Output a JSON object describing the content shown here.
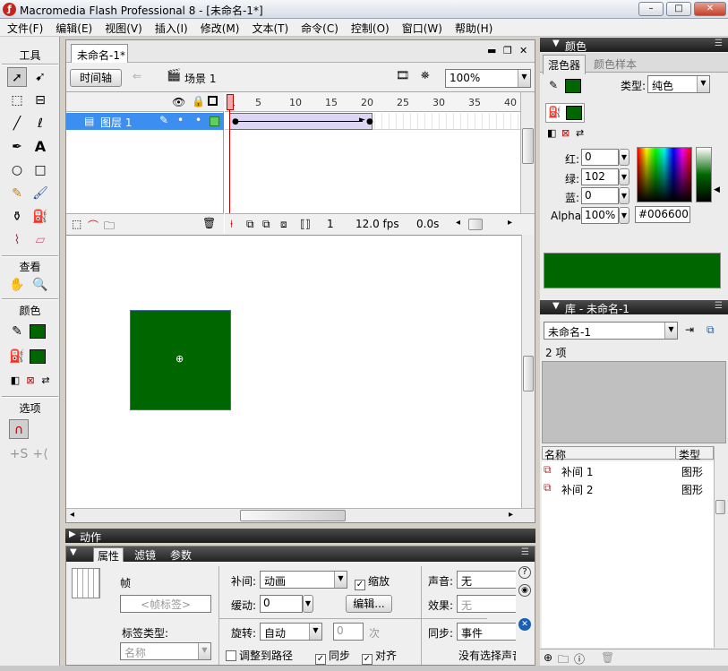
{
  "app": {
    "title": "Macromedia Flash Professional 8 - [未命名-1*]",
    "icon": "flash-icon"
  },
  "menu": [
    "文件(F)",
    "编辑(E)",
    "视图(V)",
    "插入(I)",
    "修改(M)",
    "文本(T)",
    "命令(C)",
    "控制(O)",
    "窗口(W)",
    "帮助(H)"
  ],
  "tools": {
    "title": "工具",
    "view_title": "查看",
    "color_title": "颜色",
    "options_title": "选项"
  },
  "document": {
    "tab_label": "未命名-1*",
    "timeline_button": "时间轴",
    "scene_label": "场景 1",
    "zoom": "100%"
  },
  "timeline": {
    "layer_name": "图层 1",
    "ruler": [
      "1",
      "5",
      "10",
      "15",
      "20",
      "25",
      "30",
      "35",
      "40"
    ],
    "current_frame": "1",
    "fps": "12.0 fps",
    "time": "0.0s",
    "tween_end_frame": 20
  },
  "stage": {
    "shape_color": "#006600"
  },
  "actions": {
    "label": "动作"
  },
  "properties": {
    "tabs": [
      "属性",
      "滤镜",
      "参数"
    ],
    "frame_label": "帧",
    "frame_label_placeholder": "<帧标签>",
    "label_type_label": "标签类型:",
    "label_type_value": "名称",
    "tween_label": "补间:",
    "tween_value": "动画",
    "scale_label": "缩放",
    "ease_label": "缓动:",
    "ease_value": "0",
    "edit_button": "编辑...",
    "rotate_label": "旋转:",
    "rotate_value": "自动",
    "rotate_times": "0",
    "times_unit": "次",
    "orient_to_path": "调整到路径",
    "sync": "同步",
    "snap": "对齐",
    "sound_label": "声音:",
    "sound_value": "无",
    "effect_label": "效果:",
    "effect_value": "无",
    "sync_label": "同步:",
    "sync_value": "事件",
    "no_sound": "没有选择声音"
  },
  "color_panel": {
    "title": "颜色",
    "tabs": [
      "混色器",
      "颜色样本"
    ],
    "type_label": "类型:",
    "type_value": "纯色",
    "red_label": "红:",
    "red": "0",
    "green_label": "绿:",
    "green": "102",
    "blue_label": "蓝:",
    "blue": "0",
    "alpha_label": "Alpha:",
    "alpha": "100%",
    "hex": "#006600",
    "fill_color": "#006600"
  },
  "library": {
    "title": "库 - 未命名-1",
    "doc_select": "未命名-1",
    "count": "2 项",
    "col_name": "名称",
    "col_type": "类型",
    "items": [
      {
        "name": "补间 1",
        "type": "图形"
      },
      {
        "name": "补间 2",
        "type": "图形"
      }
    ]
  }
}
